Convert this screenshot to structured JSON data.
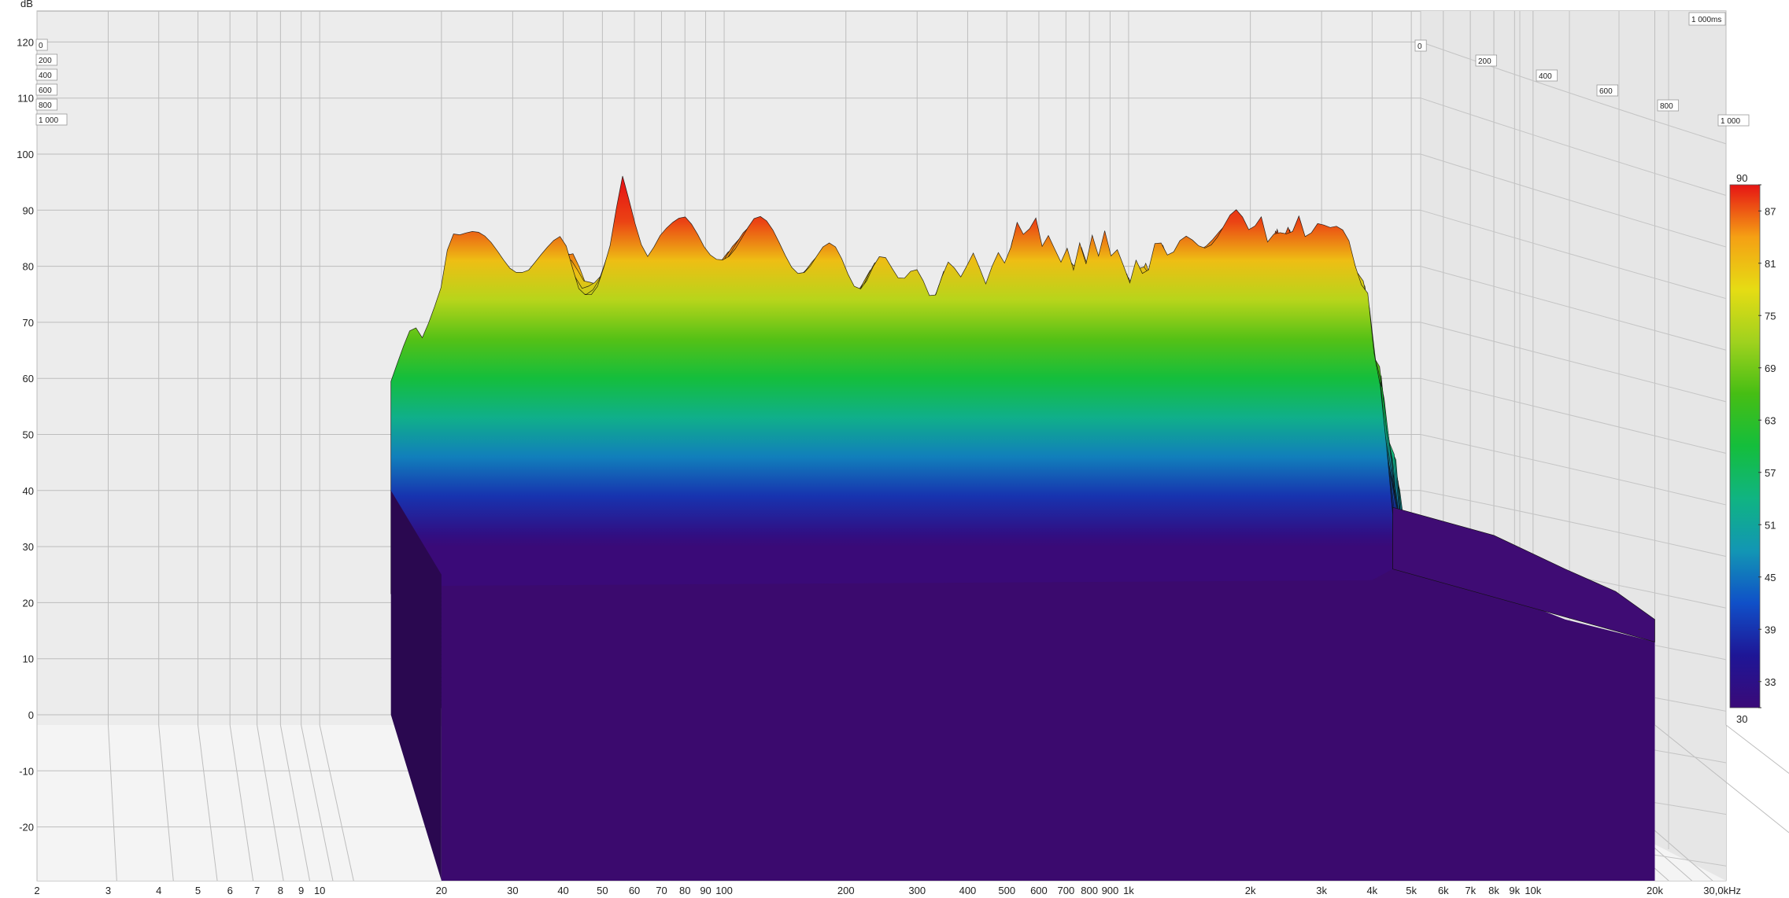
{
  "chart_data": {
    "type": "waterfall-3d",
    "yunit": "dB",
    "y_ticks": [
      "120",
      "110",
      "100",
      "90",
      "80",
      "70",
      "60",
      "50",
      "40",
      "30",
      "20",
      "10",
      "0",
      "-10",
      "-20"
    ],
    "ylim": [
      -30,
      120
    ],
    "x_ticks": [
      "2",
      "3",
      "4",
      "5",
      "6",
      "7",
      "8",
      "9",
      "10",
      "20",
      "30",
      "40",
      "50",
      "60",
      "70",
      "80",
      "90",
      "100",
      "200",
      "300",
      "400",
      "500",
      "600",
      "700",
      "800",
      "900",
      "1k",
      "2k",
      "3k",
      "4k",
      "5k",
      "6k",
      "7k",
      "8k",
      "9k",
      "10k",
      "20k",
      "30,0kHz"
    ],
    "xlim_hz": [
      2,
      30000
    ],
    "time_ticks_ms_left": [
      "0",
      "200",
      "400",
      "600",
      "800",
      "1 000"
    ],
    "time_ticks_ms_right": [
      "0",
      "200",
      "400",
      "600",
      "800",
      "1 000"
    ],
    "time_max_label": "1 000ms",
    "time_range_ms": [
      0,
      1000
    ],
    "colorbar": {
      "range_db": [
        30,
        90
      ],
      "tick_labels": [
        "90",
        "87",
        "81",
        "75",
        "69",
        "63",
        "57",
        "51",
        "45",
        "39",
        "33",
        "30"
      ],
      "stops": [
        {
          "db": 30,
          "color": "#3a0a78"
        },
        {
          "db": 36,
          "color": "#1e1696"
        },
        {
          "db": 42,
          "color": "#1050c8"
        },
        {
          "db": 48,
          "color": "#1296b4"
        },
        {
          "db": 54,
          "color": "#10b482"
        },
        {
          "db": 60,
          "color": "#14be3c"
        },
        {
          "db": 66,
          "color": "#46be14"
        },
        {
          "db": 72,
          "color": "#a0d21e"
        },
        {
          "db": 78,
          "color": "#e6dc14"
        },
        {
          "db": 84,
          "color": "#f5a014"
        },
        {
          "db": 90,
          "color": "#e61414"
        }
      ]
    },
    "front_response": [
      [
        15,
        58
      ],
      [
        17,
        66
      ],
      [
        18,
        64
      ],
      [
        20,
        76
      ],
      [
        21,
        86
      ],
      [
        22,
        85
      ],
      [
        24,
        84
      ],
      [
        28,
        82
      ],
      [
        30,
        81
      ],
      [
        33,
        81
      ],
      [
        36,
        83
      ],
      [
        40,
        87
      ],
      [
        44,
        79
      ],
      [
        48,
        78
      ],
      [
        52,
        83
      ],
      [
        56,
        95
      ],
      [
        60,
        87
      ],
      [
        64,
        81
      ],
      [
        70,
        85
      ],
      [
        80,
        86
      ],
      [
        90,
        84
      ],
      [
        100,
        85
      ],
      [
        120,
        86
      ],
      [
        150,
        82
      ],
      [
        200,
        80
      ],
      [
        250,
        79
      ],
      [
        300,
        78
      ],
      [
        350,
        78
      ],
      [
        400,
        79
      ],
      [
        450,
        80
      ],
      [
        500,
        84
      ],
      [
        550,
        86
      ],
      [
        600,
        85
      ],
      [
        700,
        83
      ],
      [
        800,
        82
      ],
      [
        900,
        83
      ],
      [
        1000,
        80
      ],
      [
        1200,
        82
      ],
      [
        1500,
        84
      ],
      [
        1800,
        86
      ],
      [
        2000,
        88
      ],
      [
        2300,
        87
      ],
      [
        2600,
        86
      ],
      [
        3000,
        85
      ],
      [
        3300,
        87
      ],
      [
        3600,
        83
      ],
      [
        3800,
        76
      ],
      [
        4000,
        68
      ],
      [
        4200,
        55
      ],
      [
        4500,
        38
      ]
    ],
    "floor_end": [
      [
        4500,
        38
      ],
      [
        8000,
        33
      ],
      [
        12000,
        30
      ],
      [
        16000,
        27
      ],
      [
        20000,
        25
      ]
    ],
    "floor_db": 30
  }
}
